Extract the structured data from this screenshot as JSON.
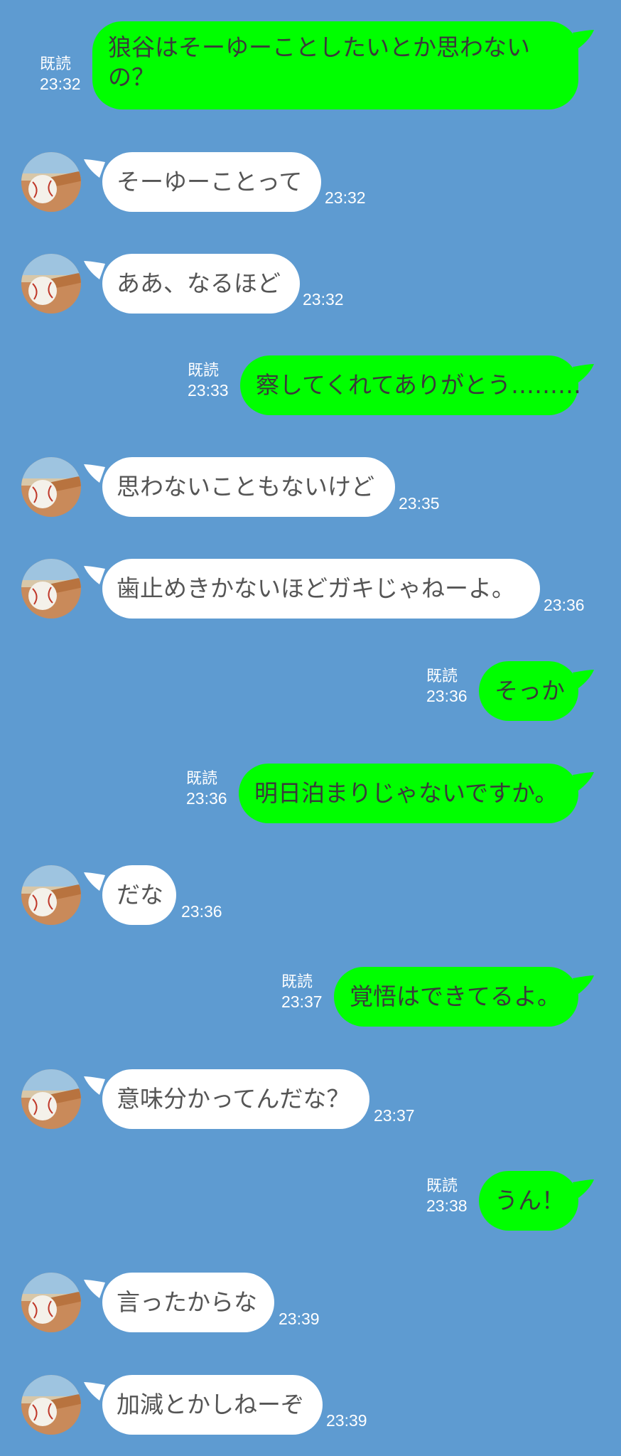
{
  "read_label": "既読",
  "colors": {
    "background": "#5e9bd1",
    "outgoing_bubble": "#00ff00",
    "incoming_bubble": "#ffffff"
  },
  "avatar_icon": "baseball-bat-photo-icon",
  "messages": [
    {
      "direction": "out",
      "text": "狼谷はそーゆーことしたいとか思わないの？",
      "read": "既読",
      "time": "23:32"
    },
    {
      "direction": "in",
      "text": "そーゆーことって",
      "time": "23:32"
    },
    {
      "direction": "in",
      "text": "ああ、なるほど",
      "time": "23:32"
    },
    {
      "direction": "out",
      "text": "察してくれてありがとう………",
      "read": "既読",
      "time": "23:33"
    },
    {
      "direction": "in",
      "text": "思わないこともないけど",
      "time": "23:35"
    },
    {
      "direction": "in",
      "text": "歯止めきかないほどガキじゃねーよ。",
      "time": "23:36"
    },
    {
      "direction": "out",
      "text": "そっか",
      "read": "既読",
      "time": "23:36"
    },
    {
      "direction": "out",
      "text": "明日泊まりじゃないですか。",
      "read": "既読",
      "time": "23:36"
    },
    {
      "direction": "in",
      "text": "だな",
      "time": "23:36"
    },
    {
      "direction": "out",
      "text": "覚悟はできてるよ。",
      "read": "既読",
      "time": "23:37"
    },
    {
      "direction": "in",
      "text": "意味分かってんだな？",
      "time": "23:37"
    },
    {
      "direction": "out",
      "text": "うん！",
      "read": "既読",
      "time": "23:38"
    },
    {
      "direction": "in",
      "text": "言ったからな",
      "time": "23:39"
    },
    {
      "direction": "in",
      "text": "加減とかしねーぞ",
      "time": "23:39"
    }
  ]
}
